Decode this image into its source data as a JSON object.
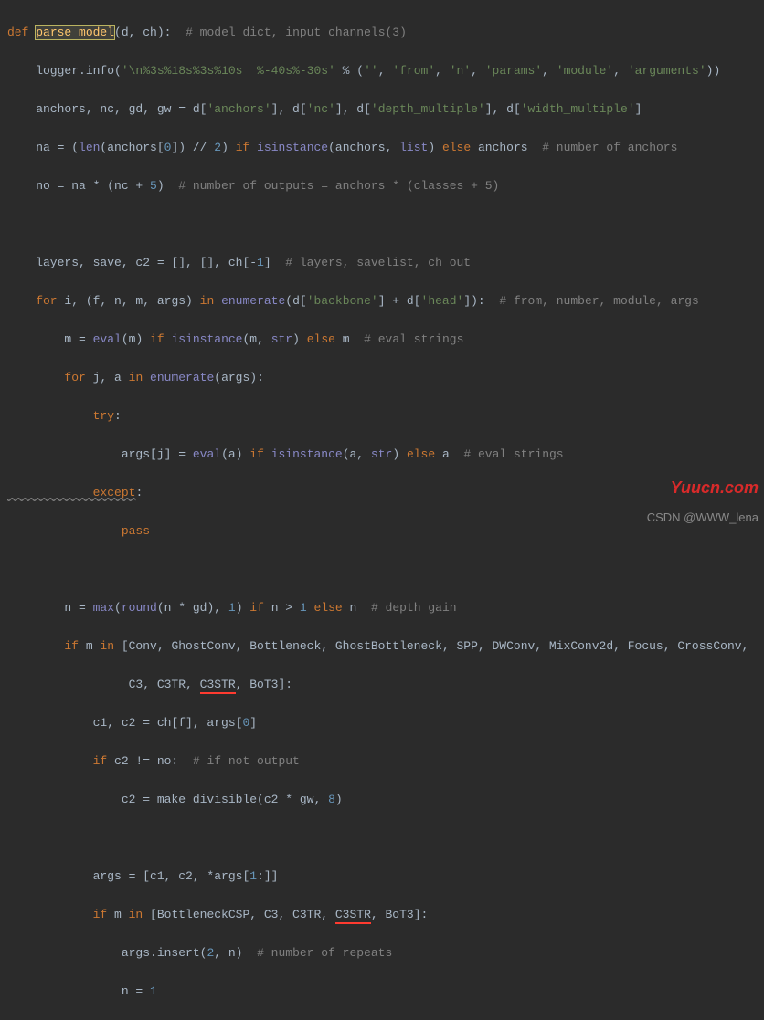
{
  "l1": {
    "def": "def ",
    "fn": "parse_model",
    "sig": "(d, ch):  ",
    "cmt": "# model_dict, input_channels(3)"
  },
  "l2": {
    "a": "    logger.info(",
    "s": "'\\n%3s%18s%3s%10s  %-40s%-30s'",
    "b": " % (",
    "s2": "''",
    "c": ", ",
    "s3": "'from'",
    "d": ", ",
    "s4": "'n'",
    "e": ", ",
    "s5": "'params'",
    "f": ", ",
    "s6": "'module'",
    "g": ", ",
    "s7": "'arguments'",
    "h": "))"
  },
  "l3": {
    "a": "    anchors, nc, gd, gw = d[",
    "s1": "'anchors'",
    "b": "], d[",
    "s2": "'nc'",
    "c": "], d[",
    "s3": "'depth_multiple'",
    "d": "], d[",
    "s4": "'width_multiple'",
    "e": "]"
  },
  "l4": {
    "a": "    na = (",
    "fn": "len",
    "b": "(anchors[",
    "n0": "0",
    "c": "]) // ",
    "n2": "2",
    "d": ") ",
    "if": "if ",
    "inst": "isinstance",
    "e": "(anchors, ",
    "list": "list",
    "f": ") ",
    "else": "else",
    "g": " anchors  ",
    "cmt": "# number of anchors"
  },
  "l5": {
    "a": "    no = na * (nc + ",
    "n": "5",
    "b": ")  ",
    "cmt": "# number of outputs = anchors * (classes + 5)"
  },
  "l7": {
    "a": "    layers, save, c2 = [], [], ch[-",
    "n": "1",
    "b": "]  ",
    "cmt": "# layers, savelist, ch out"
  },
  "l8": {
    "for": "    for ",
    "a": "i, (f, n, m, args) ",
    "in": "in ",
    "en": "enumerate",
    "b": "(d[",
    "s1": "'backbone'",
    "c": "] + d[",
    "s2": "'head'",
    "d": "]):  ",
    "cmt": "# from, number, module, args"
  },
  "l9": {
    "a": "        m = ",
    "ev": "eval",
    "b": "(m) ",
    "if": "if ",
    "inst": "isinstance",
    "c": "(m, ",
    "str": "str",
    "d": ") ",
    "else": "else",
    "e": " m  ",
    "cmt": "# eval strings"
  },
  "l10": {
    "for": "        for ",
    "a": "j, a ",
    "in": "in ",
    "en": "enumerate",
    "b": "(args):"
  },
  "l11": {
    "try": "            try",
    "a": ":"
  },
  "l12": {
    "a": "                args[j] = ",
    "ev": "eval",
    "b": "(a) ",
    "if": "if ",
    "inst": "isinstance",
    "c": "(a, ",
    "str": "str",
    "d": ") ",
    "else": "else",
    "e": " a  ",
    "cmt": "# eval strings"
  },
  "l13": {
    "ex": "            except",
    "a": ":"
  },
  "l14": {
    "pass": "                pass"
  },
  "l16": {
    "a": "        n = ",
    "mx": "max",
    "b": "(",
    "rd": "round",
    "c": "(n * gd), ",
    "n1": "1",
    "d": ") ",
    "if": "if",
    "e": " n > ",
    "n2": "1 ",
    "else": "else",
    "f": " n  ",
    "cmt": "# depth gain"
  },
  "l17": {
    "if": "        if",
    "a": " m ",
    "in": "in",
    "b": " [Conv, GhostConv, Bottleneck, GhostBottleneck, SPP, DWConv, MixConv2d, Focus, CrossConv,"
  },
  "l18": {
    "a": "                 C3, C3TR, ",
    "u": "C3STR",
    "b": ", BoT3]:"
  },
  "l19": {
    "a": "            c1, c2 = ch[f], args[",
    "n": "0",
    "b": "]"
  },
  "l20": {
    "if": "            if",
    "a": " c2 != no:  ",
    "cmt": "# if not output"
  },
  "l21": {
    "a": "                c2 = make_divisible(c2 * gw, ",
    "n": "8",
    "b": ")"
  },
  "l23": {
    "a": "            args = [c1, c2, *args[",
    "n": "1",
    "b": ":]]"
  },
  "l24": {
    "if": "            if",
    "a": " m ",
    "in": "in",
    "b": " [BottleneckCSP, C3, C3TR, ",
    "u": "C3STR",
    "c": ", BoT3]:"
  },
  "l25": {
    "a": "                args.insert(",
    "n2": "2",
    "b": ", n)  ",
    "cmt": "# number of repeats"
  },
  "l26": {
    "a": "                n = ",
    "n": "1"
  },
  "wm1": "Yuucn.com",
  "wm2": "CSDN @WWW_lena"
}
